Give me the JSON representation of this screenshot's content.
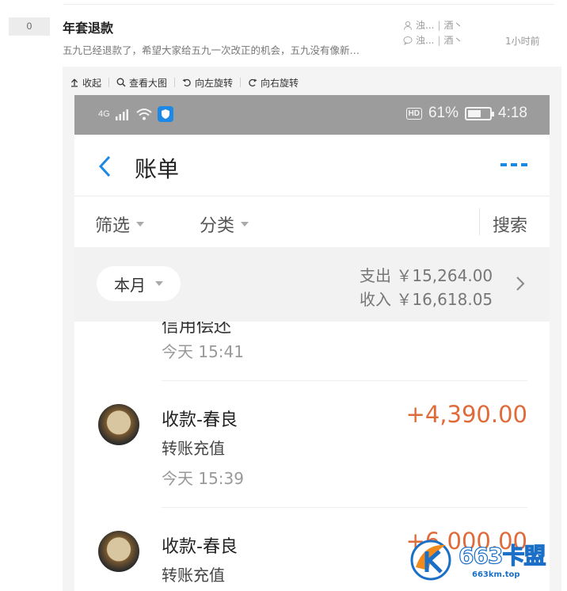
{
  "thread": {
    "reply_count": "0",
    "title": "年套退款",
    "excerpt": "五九已经退款了，希望大家给五九一次改正的机会，五九没有像新…",
    "author_short": "浊...",
    "author_tail": "酒丶",
    "last_reply_short": "浊...",
    "last_reply_tail": "酒丶",
    "time_ago": "1小时前"
  },
  "viewer_toolbar": {
    "collapse": "收起",
    "view_large": "查看大图",
    "rotate_left": "向左旋转",
    "rotate_right": "向右旋转"
  },
  "phone": {
    "status": {
      "network": "4G",
      "hd_badge": "HD",
      "battery": "61%",
      "battery_level": 0.61,
      "clock": "4:18"
    },
    "app_title": "账单",
    "filters": {
      "filter": "筛选",
      "category": "分类",
      "search": "搜索"
    },
    "summary": {
      "period": "本月",
      "expense_label": "支出",
      "expense_value": "￥15,264.00",
      "income_label": "收入",
      "income_value": "￥16,618.05"
    },
    "transactions": [
      {
        "title": "信用偿还",
        "time": "今天  15:41"
      },
      {
        "title": "收款-春良",
        "subtitle": "转账充值",
        "amount": "+4,390.00",
        "time": "今天  15:39"
      },
      {
        "title": "收款-春良",
        "subtitle": "转账充值",
        "amount": "+6,000.00"
      }
    ]
  },
  "watermark": {
    "brand": "663卡盟",
    "url": "663km.top"
  },
  "colors": {
    "accent_blue": "#1e88e5",
    "amount_orange": "#e06b3a",
    "status_bar_gray": "#9c9c9c"
  }
}
